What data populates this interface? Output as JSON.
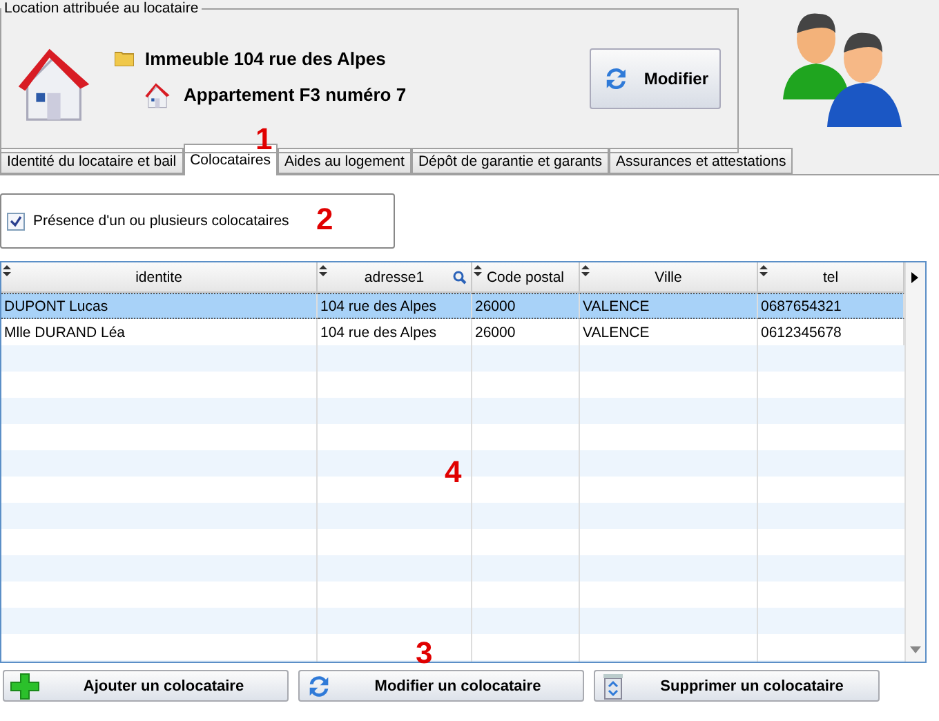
{
  "location": {
    "legend": "Location attribuée au locataire",
    "building": "Immeuble 104 rue des Alpes",
    "apartment": "Appartement F3 numéro 7",
    "button": "Modifier"
  },
  "tabs": [
    {
      "label": "Identité du locataire et bail",
      "selected": false
    },
    {
      "label": "Colocataires",
      "selected": true
    },
    {
      "label": "Aides au logement",
      "selected": false
    },
    {
      "label": "Dépôt de garantie et garants",
      "selected": false
    },
    {
      "label": "Assurances et attestations",
      "selected": false
    }
  ],
  "option": {
    "label": "Présence d'un ou plusieurs colocataires",
    "checked": true
  },
  "table": {
    "columns": [
      "identite",
      "adresse1",
      "Code postal",
      "Ville",
      "tel"
    ],
    "rows": [
      {
        "cells": [
          "DUPONT Lucas",
          "104 rue des Alpes",
          "26000",
          "VALENCE",
          "0687654321"
        ],
        "selected": true
      },
      {
        "cells": [
          "Mlle DURAND Léa",
          "104 rue des Alpes",
          "26000",
          "VALENCE",
          "0612345678"
        ],
        "selected": false
      }
    ]
  },
  "buttons": [
    {
      "label": "Ajouter un colocataire",
      "kind": "add"
    },
    {
      "label": "Modifier un colocataire",
      "kind": "edit"
    },
    {
      "label": "Supprimer un colocataire",
      "kind": "delete"
    }
  ],
  "annotations": [
    "1",
    "2",
    "3",
    "4"
  ]
}
